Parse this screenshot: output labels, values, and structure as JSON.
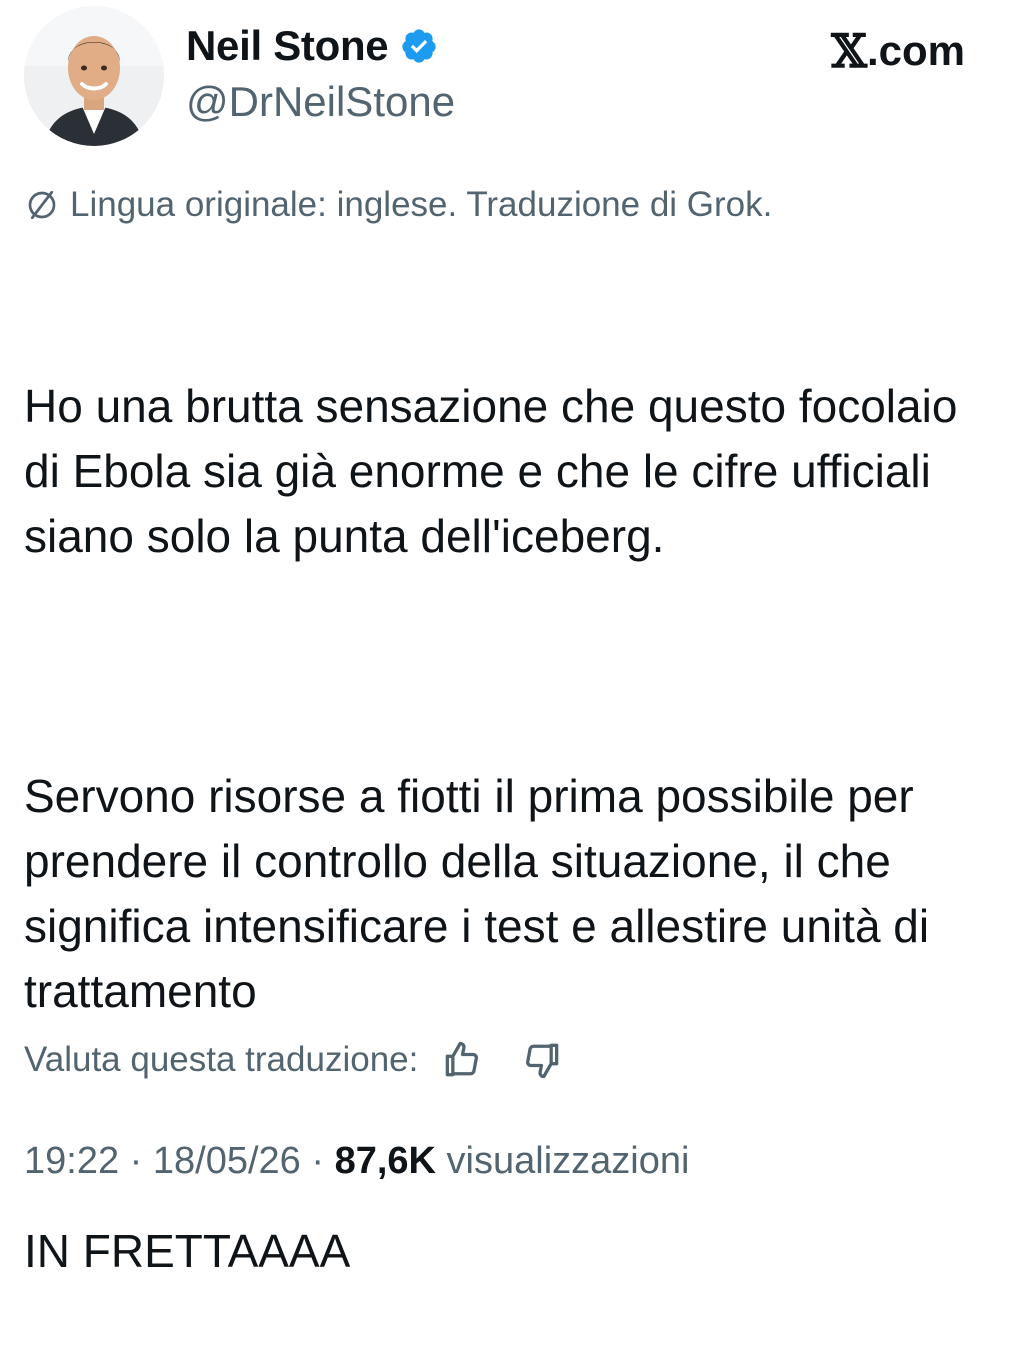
{
  "author": {
    "display_name": "Neil Stone",
    "handle": "@DrNeilStone",
    "verified": true,
    "avatar_icon": "profile-photo"
  },
  "site": {
    "label": ".com",
    "logo_glyph": "𝕏"
  },
  "translation": {
    "icon": "globe-icon",
    "note": "Lingua originale: inglese. Traduzione di Grok."
  },
  "tweet": {
    "paragraphs": [
      "Ho una brutta sensazione che questo focolaio di Ebola sia già enorme e che le cifre ufficiali siano solo la punta dell'iceberg.",
      "Servono risorse a fiotti il prima possibile per prendere il controllo della situazione, il che significa intensificare i test e allestire unità di trattamento",
      "IN FRETTAAAA"
    ]
  },
  "rating": {
    "label": "Valuta questa traduzione:",
    "thumbs_up_icon": "thumbs-up-icon",
    "thumbs_down_icon": "thumbs-down-icon"
  },
  "meta": {
    "time": "19:22",
    "separator": " · ",
    "date": "18/05/26",
    "views_count": "87,6K",
    "views_label": " visualizzazioni"
  },
  "colors": {
    "text_primary": "#0f1419",
    "text_secondary": "#536471",
    "verified_blue": "#1d9bf0"
  }
}
